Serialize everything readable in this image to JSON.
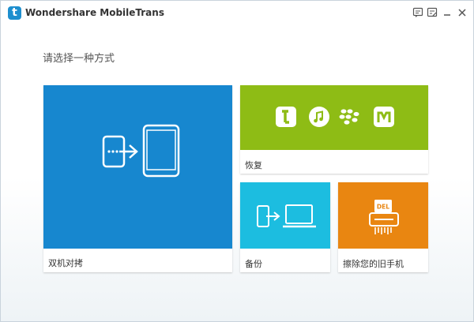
{
  "window": {
    "title": "Wondershare MobileTrans",
    "logo_letter": "t"
  },
  "titlebar_buttons": [
    "feedback-icon",
    "register-icon",
    "minimize-icon",
    "close-icon"
  ],
  "main": {
    "prompt": "请选择一种方式"
  },
  "tiles": {
    "phone_to_phone": {
      "label": "双机对拷",
      "color": "#1787cf"
    },
    "restore": {
      "label": "恢复",
      "color": "#8ebc15",
      "sources": [
        "tunes-icon",
        "itunes-icon",
        "blackberry-icon",
        "mobiletrans-icon"
      ]
    },
    "backup": {
      "label": "备份",
      "color": "#1cbde0"
    },
    "erase": {
      "label": "擦除您的旧手机",
      "color": "#e98611",
      "printer_badge": "DEL"
    }
  }
}
